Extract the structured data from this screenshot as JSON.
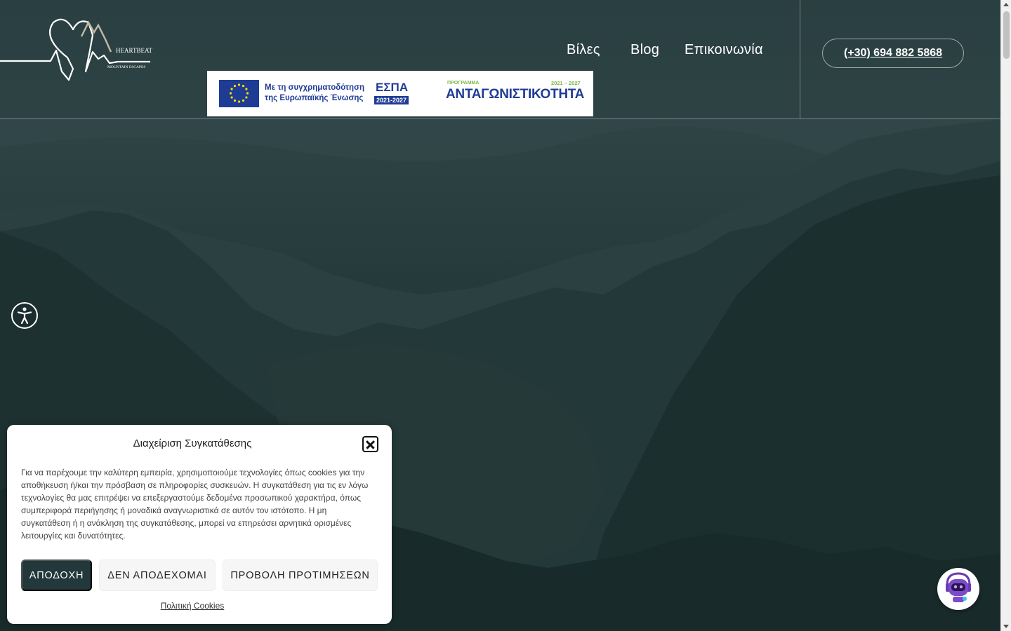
{
  "header": {
    "logo": {
      "name": "HEARTBEAT",
      "tagline": "MOUNTAIN ESCAPES"
    },
    "nav": [
      {
        "label": "Βίλες"
      },
      {
        "label": "Blog"
      },
      {
        "label": "Επικοινωνία"
      }
    ],
    "phone": "(+30) 694 882 5868"
  },
  "espa_banner": {
    "cofunding_text": "Με τη συγχρηματοδότηση της Ευρωπαϊκής Ένωσης",
    "espa_title": "ΕΣΠΑ",
    "espa_years": "2021-2027",
    "programme_label": "ΠΡΟΓΡΑΜΜΑ",
    "programme_years": "2021 – 2027",
    "programme_name": "ΑΝΤΑΓΩΝΙΣΤΙΚΟΤΗΤΑ"
  },
  "cookie_modal": {
    "title": "Διαχείριση Συγκατάθεσης",
    "body": "Για να παρέχουμε την καλύτερη εμπειρία, χρησιμοποιούμε τεχνολογίες όπως cookies για την αποθήκευση ή/και την πρόσβαση σε πληροφορίες συσκευών. Η συγκατάθεση για τις εν λόγω τεχνολογίες θα μας επιτρέψει να επεξεργαστούμε δεδομένα προσωπικού χαρακτήρα, όπως συμπεριφορά περιήγησης ή μοναδικά αναγνωριστικά σε αυτόν τον ιστότοπο. Η μη συγκατάθεση ή η ανάκληση της συγκατάθεσης, μπορεί να επηρεάσει αρνητικά ορισμένες λειτουργίες και δυνατότητες.",
    "accept_label": "ΑΠΟΔΟΧΗ",
    "deny_label": "ΔΕΝ ΑΠΟΔΕΧΟΜΑΙ",
    "prefs_label": "ΠΡΟΒΟΛΗ ΠΡΟΤΙΜΗΣΕΩΝ",
    "policy_link": "Πολιτική Cookies"
  },
  "icons": {
    "accessibility": "accessibility-icon",
    "chatbot": "robot-icon",
    "close": "close-icon"
  },
  "colors": {
    "brand_dark": "#22383a",
    "espa_blue": "#1f3c95",
    "espa_green": "#7ab648"
  }
}
